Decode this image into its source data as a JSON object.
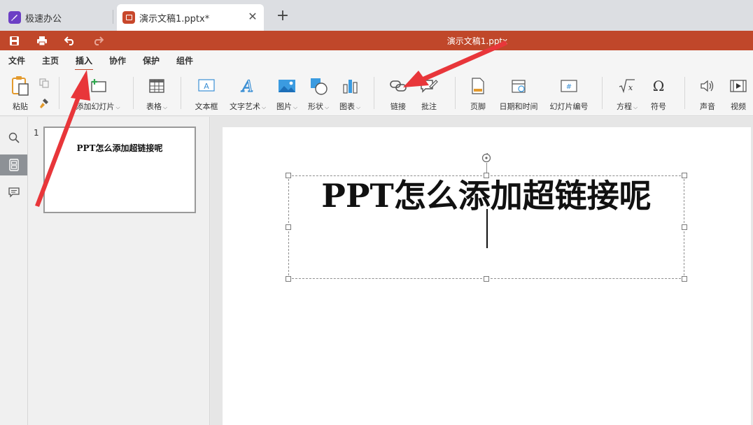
{
  "tabs": [
    {
      "label": "极速办公",
      "icon": "rocket-icon"
    },
    {
      "label": "演示文稿1.pptx*",
      "icon": "presentation-icon"
    }
  ],
  "quickbar": {
    "title": "演示文稿1.pptx"
  },
  "menu": [
    "文件",
    "主页",
    "插入",
    "协作",
    "保护",
    "组件"
  ],
  "active_menu": "插入",
  "ribbon": {
    "paste": "粘贴",
    "add_slide": "添加幻灯片",
    "table": "表格",
    "textbox": "文本框",
    "wordart": "文字艺术",
    "image": "图片",
    "shape": "形状",
    "chart": "图表",
    "link": "链接",
    "comment": "批注",
    "footer": "页脚",
    "datetime": "日期和时间",
    "slide_number": "幻灯片编号",
    "equation": "方程",
    "symbol": "符号",
    "audio": "声音",
    "video": "视频"
  },
  "thumbnail": {
    "number": "1",
    "title": "PPT怎么添加超链接呢"
  },
  "slide": {
    "title": "PPT怎么添加超链接呢"
  },
  "colors": {
    "accent": "#c0472a",
    "arrow": "#e8363a"
  }
}
